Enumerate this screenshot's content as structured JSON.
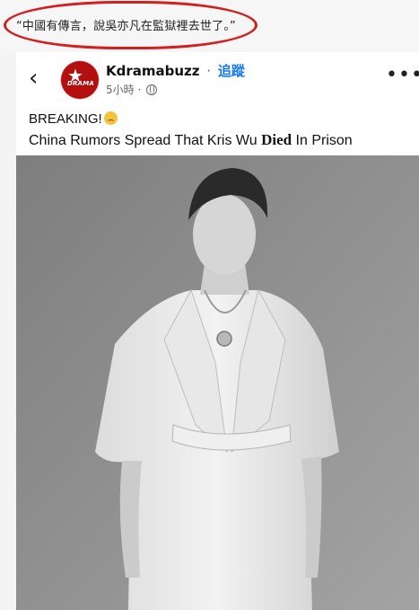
{
  "annotation": {
    "caption": "“中國有傳言，說吳亦凡在監獄裡去世了。”",
    "highlight_color": "#d21f1f"
  },
  "post": {
    "page_name": "Kdramabuzz",
    "separator": "·",
    "follow_label": "追蹤",
    "timestamp": "5小時 ·",
    "privacy_icon": "globe-icon",
    "avatar_text": "DRAMA",
    "back_icon": "chevron-left-icon",
    "more_icon": "more-horizontal-icon",
    "text_line1": "BREAKING!",
    "emoji_icon": "weary-face-icon",
    "text_line2_before": "China Rumors Spread That Kris Wu ",
    "text_line2_bold": "Died",
    "text_line2_after": " In Prison",
    "accent_color": "#1877f2",
    "photo_description_icon": "person-photo"
  }
}
